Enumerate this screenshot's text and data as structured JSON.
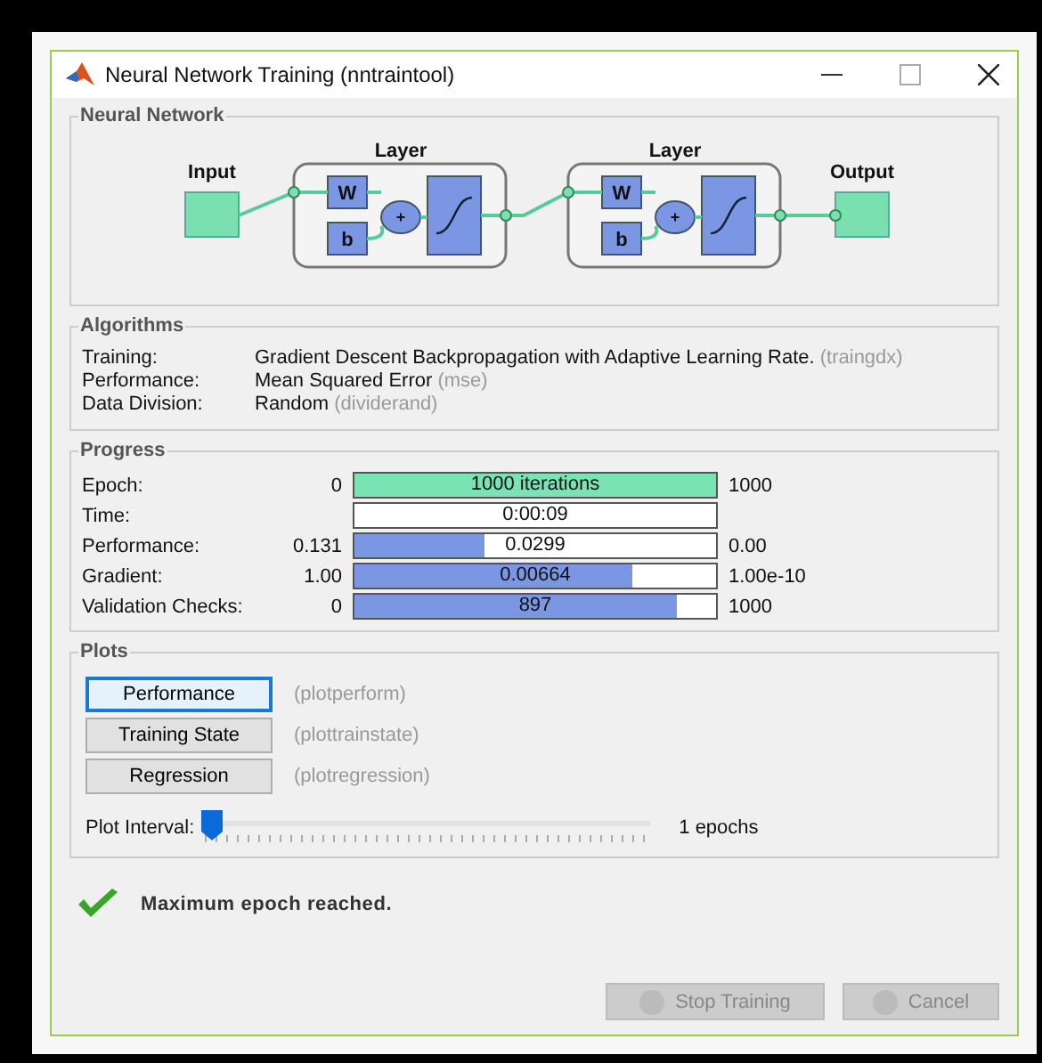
{
  "window": {
    "title": "Neural Network Training (nntraintool)"
  },
  "network": {
    "legend": "Neural Network",
    "input_label": "Input",
    "output_label": "Output",
    "layers": [
      {
        "title": "Layer",
        "weight": "W",
        "bias": "b",
        "sum": "+"
      },
      {
        "title": "Layer",
        "weight": "W",
        "bias": "b",
        "sum": "+"
      }
    ]
  },
  "algorithms": {
    "legend": "Algorithms",
    "rows": [
      {
        "label": "Training:",
        "value": "Gradient Descent Backpropagation with Adaptive Learning Rate.",
        "code": "(traingdx)"
      },
      {
        "label": "Performance:",
        "value": "Mean Squared Error",
        "code": "(mse)"
      },
      {
        "label": "Data Division:",
        "value": "Random",
        "code": "(dividerand)"
      }
    ]
  },
  "progress": {
    "legend": "Progress",
    "rows": [
      {
        "kind": "meter",
        "label": "Epoch:",
        "start": "0",
        "reading": "1000 iterations",
        "end": "1000",
        "level": 1,
        "color": "#79e3b3"
      },
      {
        "kind": "readout",
        "label": "Time:",
        "reading": "0:00:09"
      },
      {
        "kind": "meter",
        "label": "Performance:",
        "start": "0.131",
        "reading": "0.0299",
        "end": "0.00",
        "level": 0.36,
        "color": "#7b96e3"
      },
      {
        "kind": "meter",
        "label": "Gradient:",
        "start": "1.00",
        "reading": "0.00664",
        "end": "1.00e-10",
        "level": 0.77,
        "color": "#7b96e3"
      },
      {
        "kind": "meter",
        "label": "Validation Checks:",
        "start": "0",
        "reading": "897",
        "end": "1000",
        "level": 0.89,
        "color": "#7b96e3"
      }
    ]
  },
  "plots": {
    "legend": "Plots",
    "buttons": [
      {
        "label": "Performance",
        "function": "(plotperform)",
        "focused": true
      },
      {
        "label": "Training State",
        "function": "(plottrainstate)",
        "focused": false
      },
      {
        "label": "Regression",
        "function": "(plotregression)",
        "focused": false
      }
    ],
    "interval": {
      "label": "Plot Interval:",
      "level": 0,
      "reading": "1 epochs"
    }
  },
  "status": {
    "message": "Maximum epoch reached."
  },
  "buttons": [
    {
      "label": "Stop Training",
      "disabled": true
    },
    {
      "label": "Cancel",
      "disabled": true
    }
  ]
}
